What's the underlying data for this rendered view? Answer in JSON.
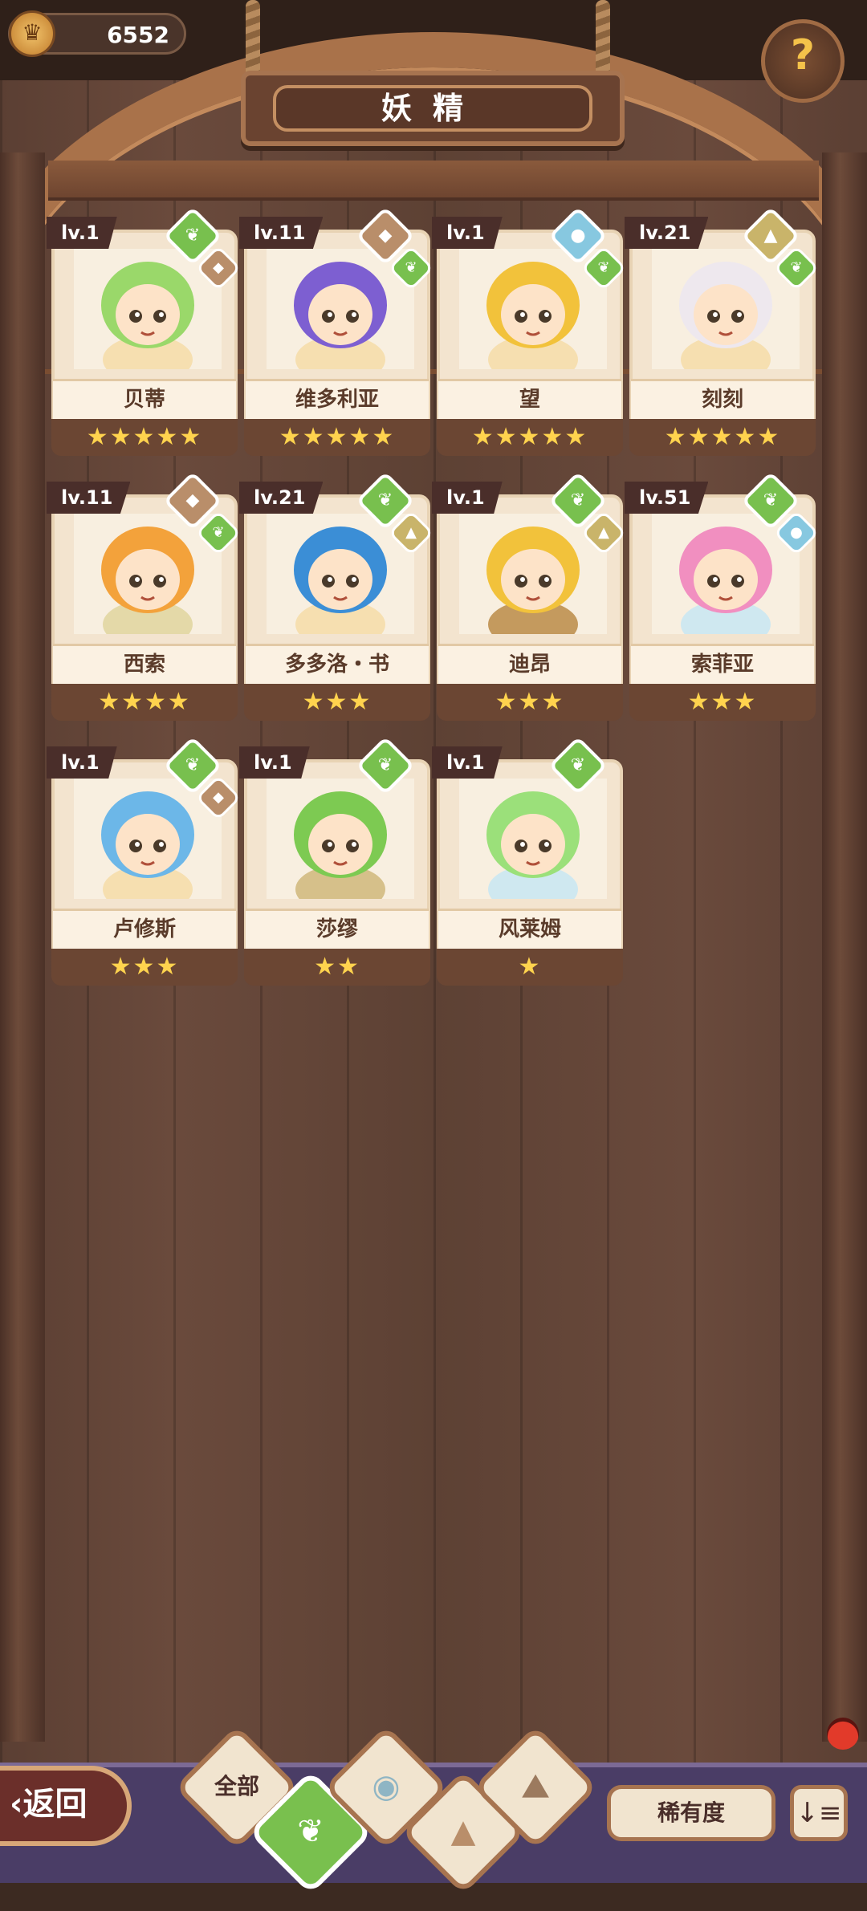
{
  "header": {
    "coins": "6552",
    "title": "妖精",
    "help_label": "?"
  },
  "fairies": [
    {
      "level": "lv.1",
      "name": "贝蒂",
      "stars": 5,
      "element": "grass",
      "sub_element": "earth",
      "colors": [
        "#9ad86a",
        "#f6dfb0"
      ]
    },
    {
      "level": "lv.11",
      "name": "维多利亚",
      "stars": 5,
      "element": "earth",
      "sub_element": "grass",
      "colors": [
        "#7d5fd1",
        "#f6dfb0"
      ]
    },
    {
      "level": "lv.1",
      "name": "望",
      "stars": 5,
      "element": "water",
      "sub_element": "grass",
      "colors": [
        "#f2c23b",
        "#f6dfb0"
      ]
    },
    {
      "level": "lv.21",
      "name": "刻刻",
      "stars": 5,
      "element": "sand",
      "sub_element": "grass",
      "colors": [
        "#eee8ee",
        "#f6dfb0"
      ]
    },
    {
      "level": "lv.11",
      "name": "西索",
      "stars": 4,
      "element": "earth",
      "sub_element": "grass",
      "colors": [
        "#f3a23b",
        "#e4d9a8"
      ]
    },
    {
      "level": "lv.21",
      "name": "多多洛・书",
      "stars": 3,
      "element": "grass",
      "sub_element": "sand",
      "colors": [
        "#3b8ed6",
        "#f6dfb0"
      ]
    },
    {
      "level": "lv.1",
      "name": "迪昂",
      "stars": 3,
      "element": "grass",
      "sub_element": "sand",
      "colors": [
        "#f2c23b",
        "#c49a5e"
      ]
    },
    {
      "level": "lv.51",
      "name": "索菲亚",
      "stars": 3,
      "element": "grass",
      "sub_element": "water",
      "colors": [
        "#f18fc0",
        "#cfe8f0"
      ]
    },
    {
      "level": "lv.1",
      "name": "卢修斯",
      "stars": 3,
      "element": "grass",
      "sub_element": "earth",
      "colors": [
        "#6cb7e8",
        "#f6dfb0"
      ]
    },
    {
      "level": "lv.1",
      "name": "莎缪",
      "stars": 2,
      "element": "grass",
      "sub_element": "",
      "colors": [
        "#7dca52",
        "#d6c08a"
      ]
    },
    {
      "level": "lv.1",
      "name": "风莱姆",
      "stars": 1,
      "element": "grass",
      "sub_element": "",
      "colors": [
        "#9be07a",
        "#cfe8f0"
      ]
    }
  ],
  "bottom": {
    "back_label": "返回",
    "filters": [
      {
        "label": "全部",
        "icon": "all-icon"
      },
      {
        "label": "",
        "icon": "grass-sprout-icon"
      },
      {
        "label": "",
        "icon": "water-drop-icon"
      },
      {
        "label": "",
        "icon": "earth-rock-icon"
      },
      {
        "label": "",
        "icon": "mountain-icon"
      }
    ],
    "rarity_label": "稀有度",
    "sort_label": "↓≡"
  }
}
